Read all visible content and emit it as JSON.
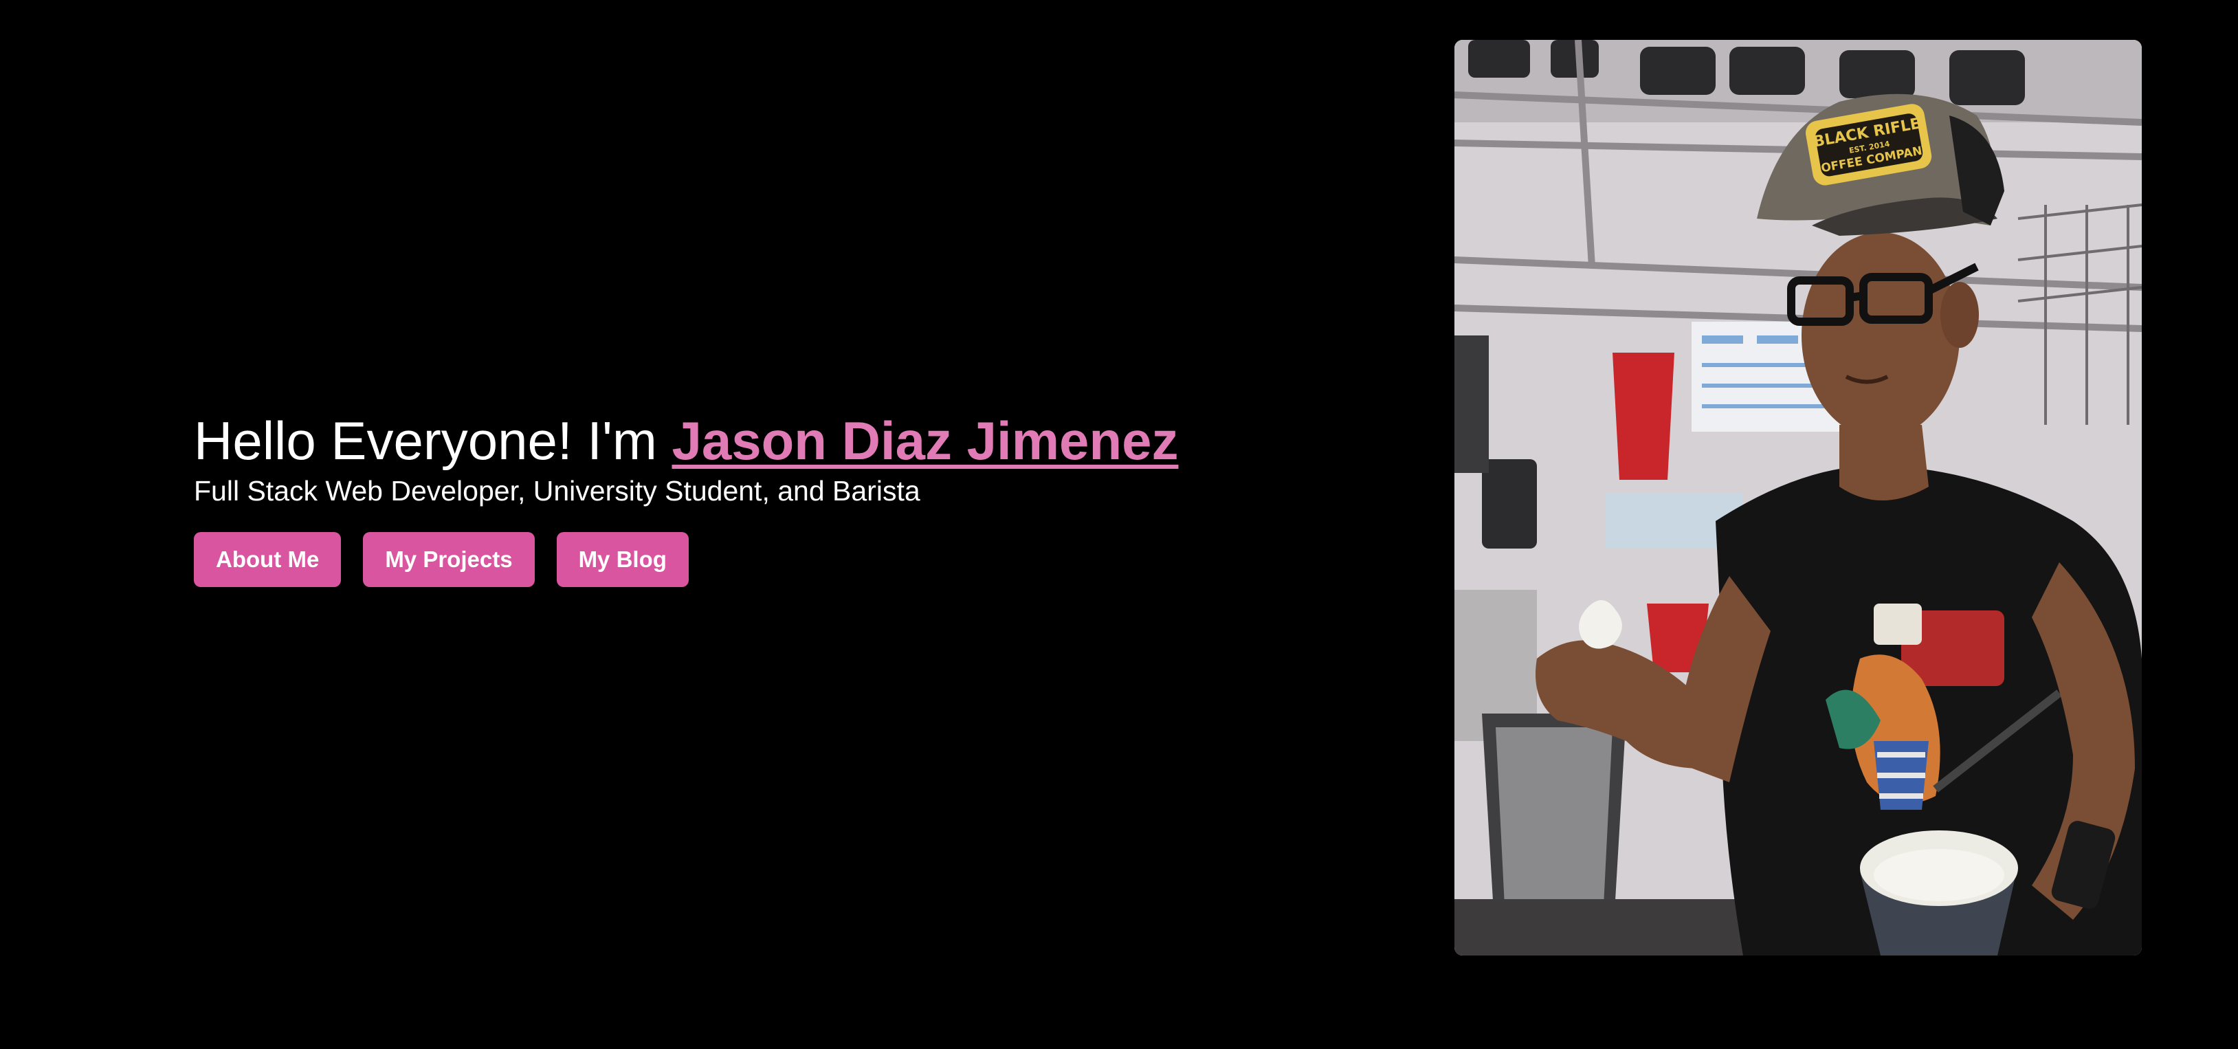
{
  "hero": {
    "greeting": "Hello Everyone! I'm ",
    "name": "Jason Diaz Jimenez",
    "tagline": "Full Stack Web Developer, University Student, and Barista"
  },
  "nav_buttons": [
    {
      "label": "About Me"
    },
    {
      "label": "My Projects"
    },
    {
      "label": "My Blog"
    }
  ],
  "photo": {
    "hat_text": [
      "BLACK RIFLE",
      "EST. 2014",
      "COFFEE COMPANY"
    ]
  },
  "colors": {
    "background": "#000000",
    "accent": "#d9559f",
    "name_link": "#e07bb5",
    "text": "#ffffff"
  }
}
